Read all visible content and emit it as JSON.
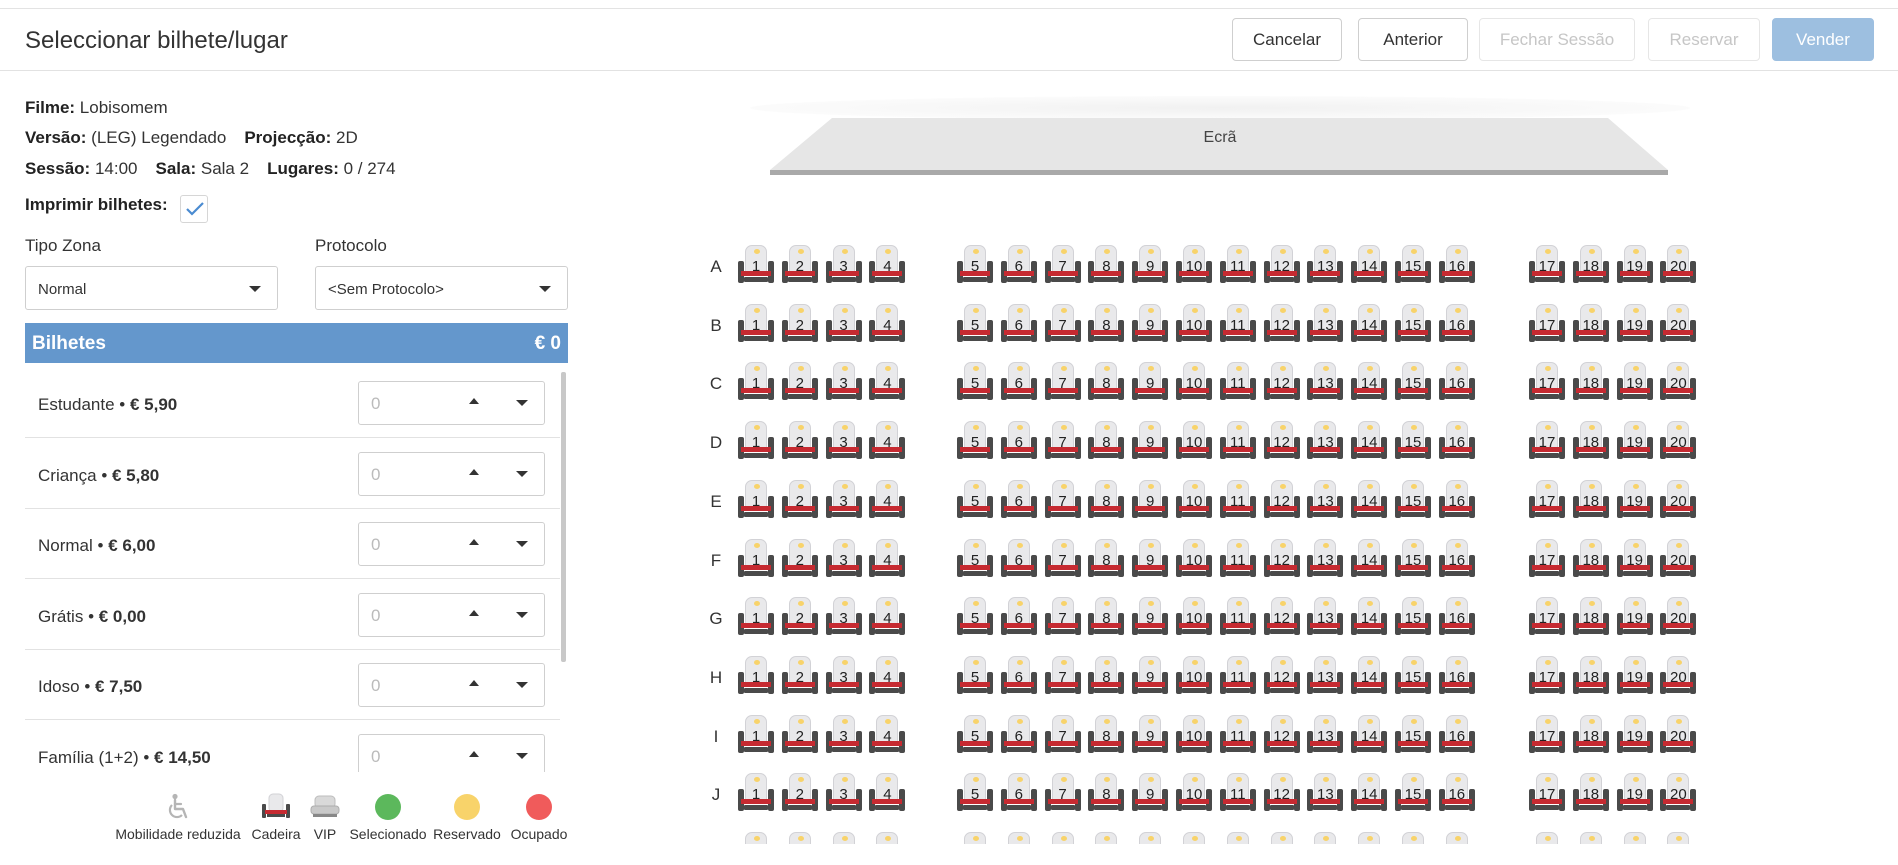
{
  "header": {
    "title": "Seleccionar bilhete/lugar",
    "buttons": {
      "cancel": "Cancelar",
      "previous": "Anterior",
      "close_session": "Fechar Sessão",
      "reserve": "Reservar",
      "sell": "Vender"
    }
  },
  "info": {
    "film_label": "Filme:",
    "film": "Lobisomem",
    "version_label": "Versão:",
    "version": "(LEG) Legendado",
    "projection_label": "Projecção:",
    "projection": "2D",
    "session_label": "Sessão:",
    "session": "14:00",
    "room_label": "Sala:",
    "room": "Sala 2",
    "seats_label": "Lugares:",
    "seats": "0 / 274",
    "print_label": "Imprimir bilhetes:",
    "print_checked": true
  },
  "filters": {
    "zone_label": "Tipo Zona",
    "zone_value": "Normal",
    "protocol_label": "Protocolo",
    "protocol_value": "<Sem Protocolo>"
  },
  "tickets": {
    "title": "Bilhetes",
    "total": "€ 0",
    "items": [
      {
        "name": "Estudante",
        "price": "€ 5,90",
        "qty": "0"
      },
      {
        "name": "Criança",
        "price": "€ 5,80",
        "qty": "0"
      },
      {
        "name": "Normal",
        "price": "€ 6,00",
        "qty": "0"
      },
      {
        "name": "Grátis",
        "price": "€ 0,00",
        "qty": "0"
      },
      {
        "name": "Idoso",
        "price": "€ 7,50",
        "qty": "0"
      },
      {
        "name": "Família (1+2)",
        "price": "€ 14,50",
        "qty": "0"
      }
    ]
  },
  "legend": {
    "reduced_mobility": "Mobilidade reduzida",
    "chair": "Cadeira",
    "vip": "VIP",
    "selected": "Selecionado",
    "reserved": "Reservado",
    "occupied": "Ocupado",
    "colors": {
      "selected": "#5cb85c",
      "reserved": "#f8d36a",
      "occupied": "#f05b5b"
    }
  },
  "seatmap": {
    "screen_label": "Ecrã",
    "rows": [
      "A",
      "B",
      "C",
      "D",
      "E",
      "F",
      "G",
      "H",
      "I",
      "J"
    ],
    "blocks": [
      {
        "seats": [
          "1",
          "2",
          "3",
          "4"
        ]
      },
      {
        "seats": [
          "5",
          "6",
          "7",
          "8",
          "9",
          "10",
          "11",
          "12",
          "13",
          "14",
          "15",
          "16"
        ]
      },
      {
        "seats": [
          "17",
          "18",
          "19",
          "20"
        ]
      }
    ]
  }
}
